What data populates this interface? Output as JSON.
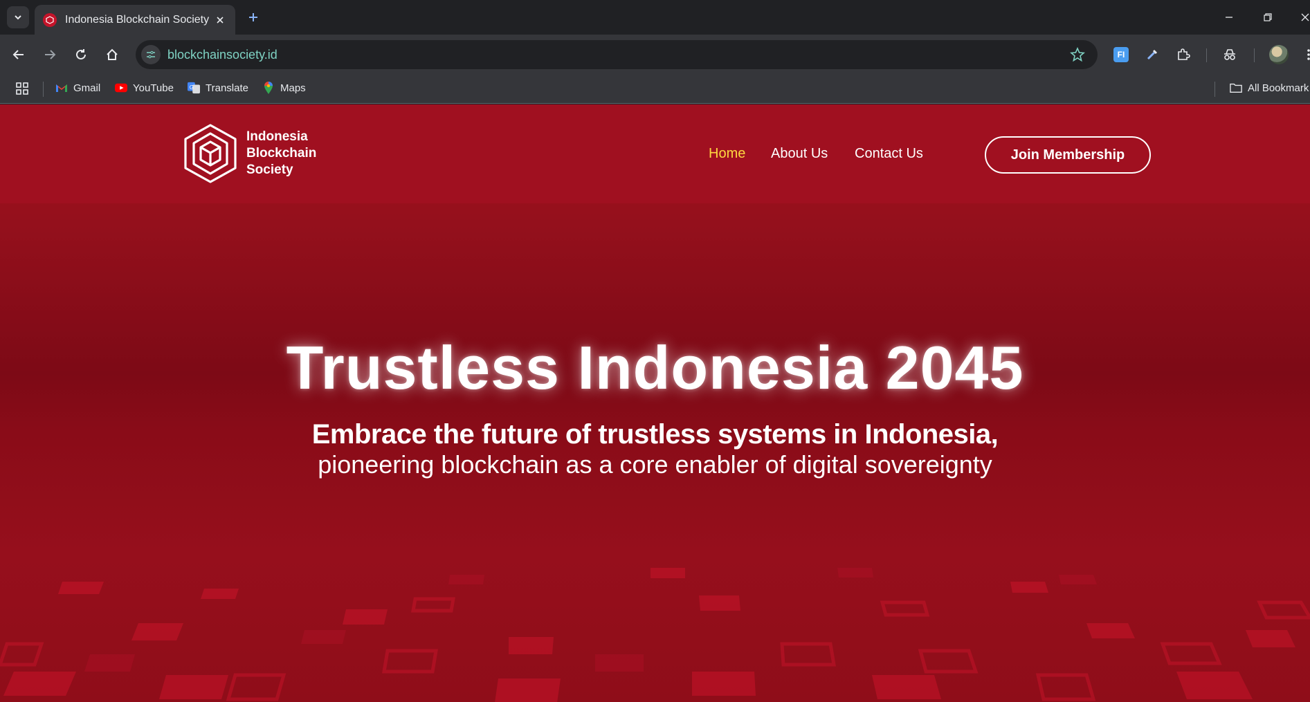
{
  "browser": {
    "tab_title": "Indonesia Blockchain Society",
    "url": "blockchainsociety.id",
    "bookmarks": [
      {
        "label": "Gmail",
        "icon": "gmail-icon"
      },
      {
        "label": "YouTube",
        "icon": "youtube-icon"
      },
      {
        "label": "Translate",
        "icon": "translate-icon"
      },
      {
        "label": "Maps",
        "icon": "maps-icon"
      }
    ],
    "all_bookmarks": "All Bookmark"
  },
  "site": {
    "logo_line1": "Indonesia",
    "logo_line2": "Blockchain",
    "logo_line3": "Society",
    "nav": [
      {
        "label": "Home",
        "active": true
      },
      {
        "label": "About Us",
        "active": false
      },
      {
        "label": "Contact Us",
        "active": false
      }
    ],
    "cta": "Join Membership"
  },
  "hero": {
    "title": "Trustless Indonesia 2045",
    "subtitle_line1": "Embrace the future of trustless systems in Indonesia,",
    "subtitle_line2": "pioneering blockchain as a core enabler of digital sovereignty"
  },
  "colors": {
    "brand_red": "#a01020",
    "nav_active": "#ffd740",
    "omnibox_text": "#7fd3c4"
  }
}
